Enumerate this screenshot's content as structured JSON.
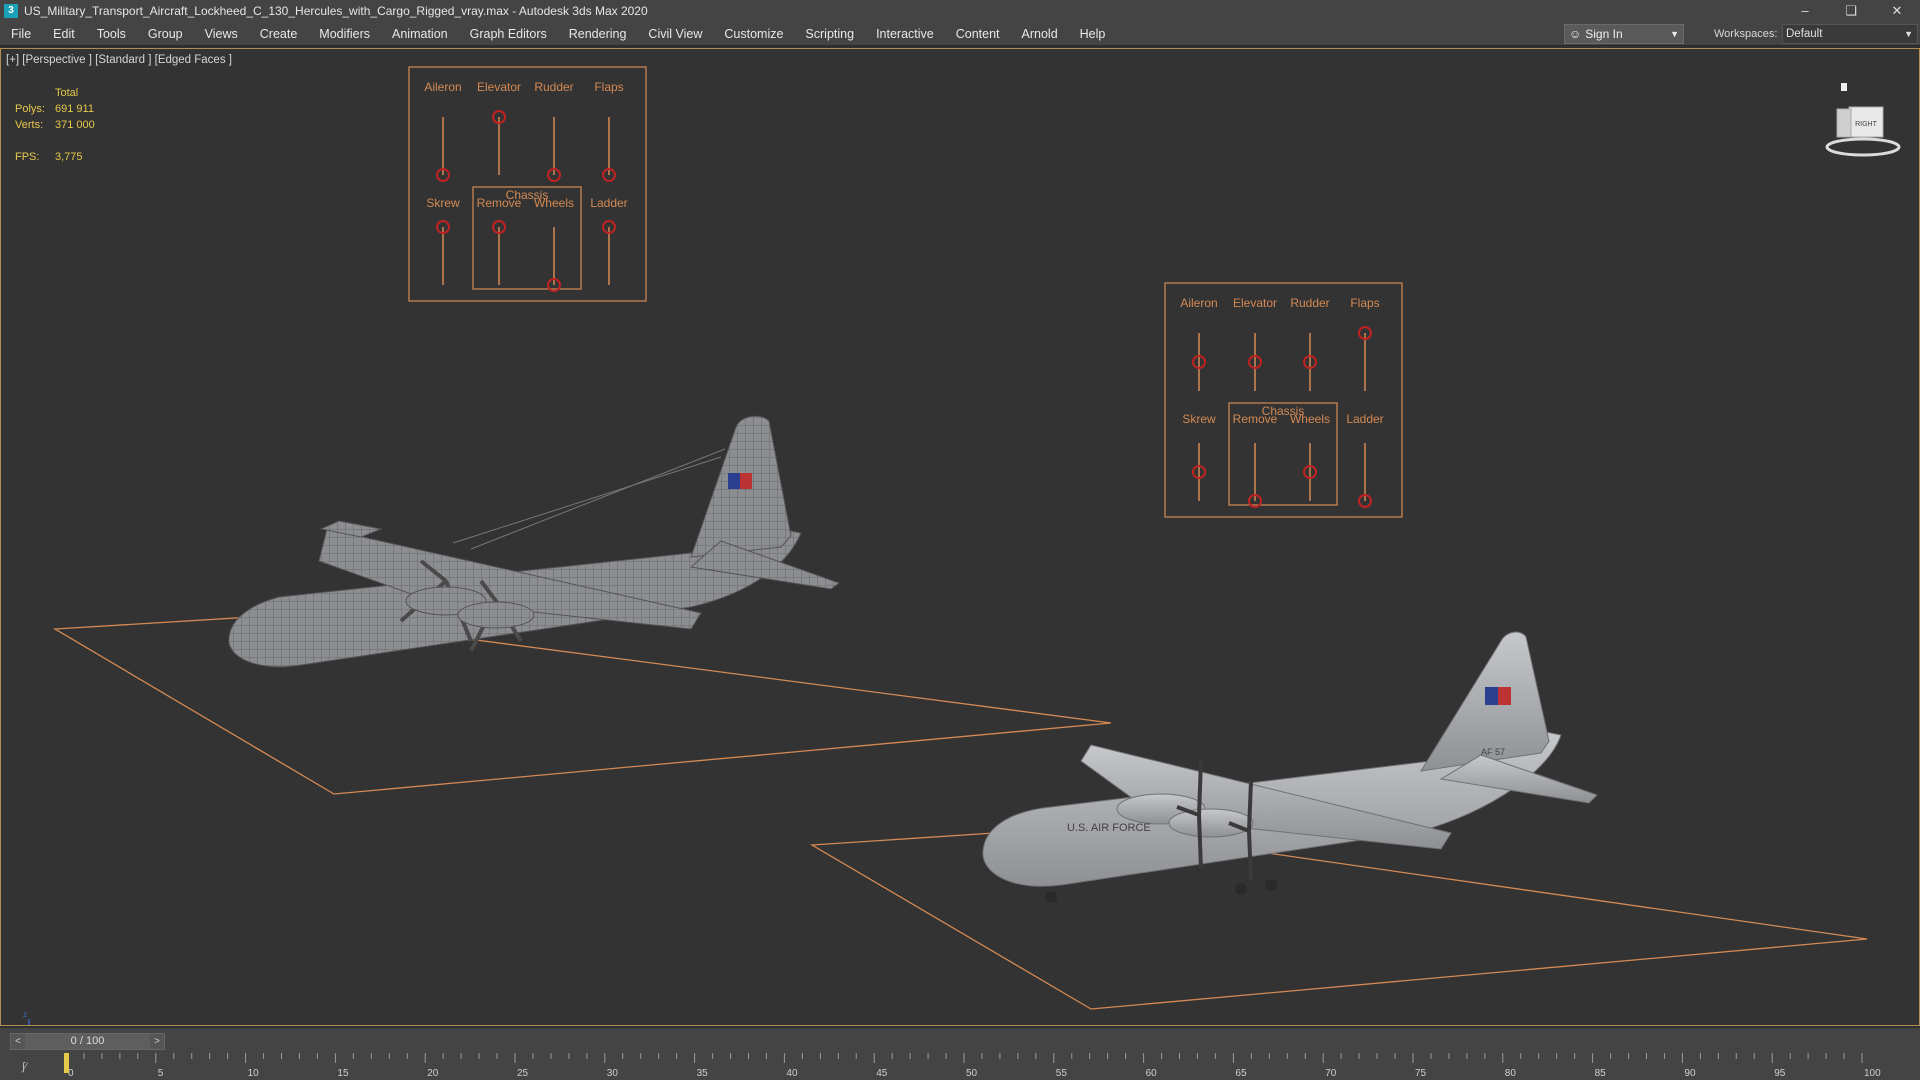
{
  "window": {
    "title": "US_Military_Transport_Aircraft_Lockheed_C_130_Hercules_with_Cargo_Rigged_vray.max - Autodesk 3ds Max 2020",
    "app_icon": "3"
  },
  "menu": [
    {
      "key": "file",
      "label": "File"
    },
    {
      "key": "edit",
      "label": "Edit"
    },
    {
      "key": "tools",
      "label": "Tools"
    },
    {
      "key": "group",
      "label": "Group"
    },
    {
      "key": "views",
      "label": "Views"
    },
    {
      "key": "create",
      "label": "Create"
    },
    {
      "key": "modifiers",
      "label": "Modifiers"
    },
    {
      "key": "animation",
      "label": "Animation"
    },
    {
      "key": "graph-editors",
      "label": "Graph Editors"
    },
    {
      "key": "rendering",
      "label": "Rendering"
    },
    {
      "key": "civil-view",
      "label": "Civil View"
    },
    {
      "key": "customize",
      "label": "Customize"
    },
    {
      "key": "scripting",
      "label": "Scripting"
    },
    {
      "key": "interactive",
      "label": "Interactive"
    },
    {
      "key": "content",
      "label": "Content"
    },
    {
      "key": "arnold",
      "label": "Arnold"
    },
    {
      "key": "help",
      "label": "Help"
    }
  ],
  "account": {
    "signin_label": "Sign In",
    "workspaces_label": "Workspaces:",
    "workspace_value": "Default"
  },
  "viewport": {
    "label": "[+] [Perspective ] [Standard ] [Edged Faces ]",
    "stats": {
      "header": "Total",
      "polys_label": "Polys:",
      "polys_value": "691 911",
      "verts_label": "Verts:",
      "verts_value": "371 000",
      "fps_label": "FPS:",
      "fps_value": "3,775"
    },
    "viewcube_label": "RIGHT",
    "axis_labels": [
      "z",
      "x",
      "y"
    ]
  },
  "rig_panels": [
    {
      "top_labels": [
        "Aileron",
        "Elevator",
        "Rudder",
        "Flaps"
      ],
      "group_label": "Chassis",
      "bottom_labels": [
        "Skrew",
        "Remove",
        "Wheels",
        "Ladder"
      ],
      "top_levels": [
        0,
        1,
        0,
        0
      ],
      "bottom_levels": [
        1,
        1,
        0,
        1
      ]
    },
    {
      "top_labels": [
        "Aileron",
        "Elevator",
        "Rudder",
        "Flaps"
      ],
      "group_label": "Chassis",
      "bottom_labels": [
        "Skrew",
        "Remove",
        "Wheels",
        "Ladder"
      ],
      "top_levels": [
        0.5,
        0.5,
        0.5,
        1
      ],
      "bottom_levels": [
        0.5,
        0,
        0.5,
        0
      ]
    }
  ],
  "aircraft_labels": {
    "tail_number": "AF 57",
    "fuselage": "U.S. AIR FORCE"
  },
  "timeline": {
    "frame_display": "0 / 100",
    "ticks": [
      "0",
      "5",
      "10",
      "15",
      "20",
      "25",
      "30",
      "35",
      "40",
      "45",
      "50",
      "55",
      "60",
      "65",
      "70",
      "75",
      "80",
      "85",
      "90",
      "95",
      "100"
    ]
  },
  "colors": {
    "accent": "#d48a54",
    "handle": "#c02222",
    "stats": "#e6c84a"
  }
}
